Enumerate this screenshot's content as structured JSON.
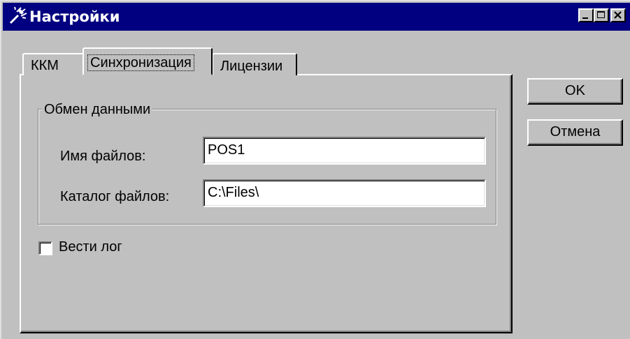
{
  "window": {
    "title": "Настройки",
    "icon": "settings-wand-icon",
    "controls": [
      "minimize-icon",
      "maximize-icon",
      "close-icon"
    ]
  },
  "tabs": [
    {
      "label": "ККМ",
      "active": false
    },
    {
      "label": "Синхронизация",
      "active": true
    },
    {
      "label": "Лицензии",
      "active": false
    }
  ],
  "exchange_group": {
    "title": "Обмен данными",
    "file_name_label": "Имя файлов:",
    "file_name_value": "POS1",
    "file_dir_label": "Каталог файлов:",
    "file_dir_value": "C:\\Files\\"
  },
  "log_checkbox": {
    "label": "Вести лог",
    "checked": false
  },
  "buttons": {
    "ok_label": "OK",
    "cancel_label": "Отмена"
  },
  "colors": {
    "titlebar": "#000080",
    "face": "#c0c0c0"
  }
}
